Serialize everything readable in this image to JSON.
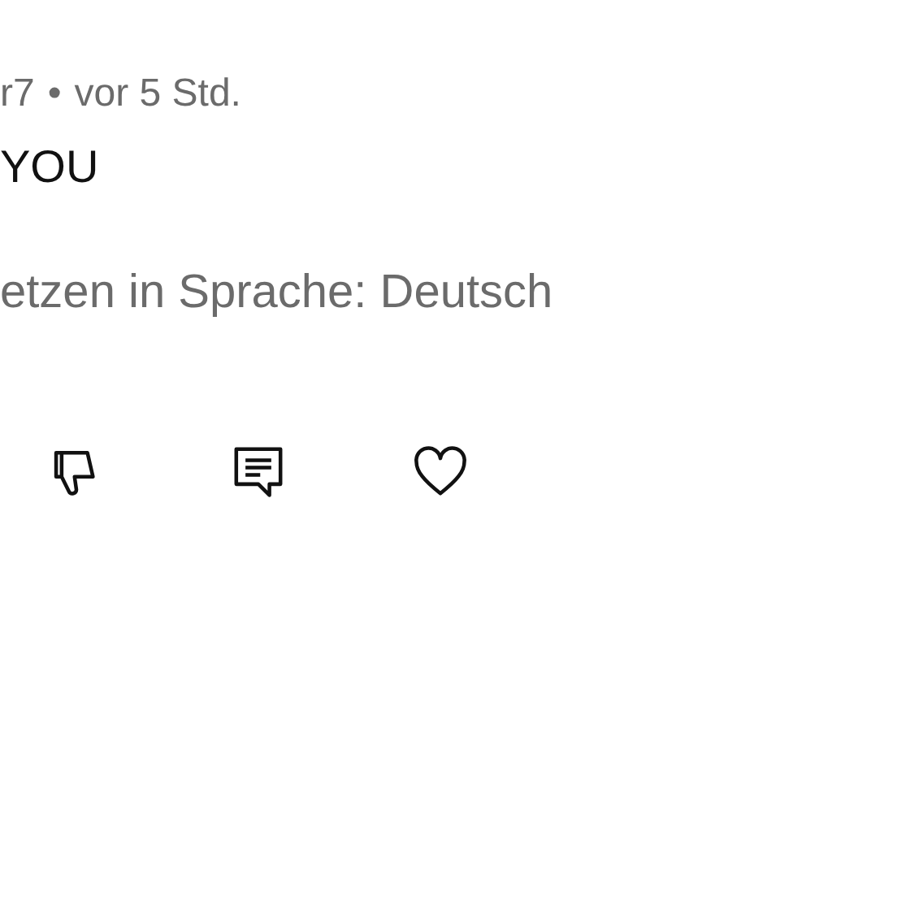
{
  "comment": {
    "author": "r7",
    "separator": "•",
    "time": "vor 5 Std.",
    "text": "YOU",
    "translate_link": "etzen in Sprache: Deutsch"
  },
  "actions": [
    {
      "kind": "dislike"
    },
    {
      "kind": "reply"
    },
    {
      "kind": "like"
    }
  ]
}
